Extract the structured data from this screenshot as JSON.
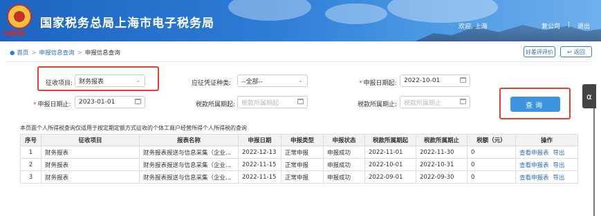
{
  "header": {
    "logo_text": "中國稅務",
    "title": "国家税务总局上海市电子税务局",
    "welcome": "欢迎, 上海",
    "company": "复公司",
    "separator": "|",
    "logout": "退出"
  },
  "breadcrumb": {
    "home": "首页",
    "sep1": ">",
    "level1": "申报信息查询",
    "sep2": ">",
    "current": "申报信息查询"
  },
  "actions": {
    "rating": "好差评评价",
    "back": "返回"
  },
  "form": {
    "collect_item_label": "征收项目:",
    "collect_item_value": "财务报表",
    "voucher_type_label": "应征凭证种类:",
    "voucher_type_value": "--全部--",
    "declare_start_label": "申报日期起:",
    "declare_start_value": "2022-10-01",
    "declare_end_label": "申报日期止:",
    "declare_end_value": "2023-01-01",
    "tax_period_start_label": "税款所属期起:",
    "tax_period_start_placeholder": "税款所属期起",
    "tax_period_end_label": "税款所属期止:",
    "tax_period_end_placeholder": "税款所属期止",
    "query_button": "查询"
  },
  "note": "本页面个人所得税查询仅适用于按定期定额方式征收的个体工商户经营所得个人所得税的查询",
  "table": {
    "headers": [
      "序号",
      "征收项目",
      "报表名称",
      "申报日期",
      "申报类型",
      "申报状态",
      "税款所属期起",
      "税款所属期止",
      "税额（元）",
      "操作"
    ],
    "rows": [
      {
        "no": "1",
        "item": "财务报表",
        "report": "财务报表报送与信息采集（企业...",
        "date": "2022-12-13",
        "type": "正常申报",
        "status": "申报成功",
        "start": "2022-11-01",
        "end": "2022-11-30",
        "amount": "0",
        "view": "查看申报表",
        "export": "导出"
      },
      {
        "no": "2",
        "item": "财务报表",
        "report": "财务报表报送与信息采集（企业...",
        "date": "2022-11-15",
        "type": "正常申报",
        "status": "申报成功",
        "start": "2022-10-01",
        "end": "2022-10-31",
        "amount": "0",
        "view": "查看申报表",
        "export": "导出"
      },
      {
        "no": "3",
        "item": "财务报表",
        "report": "财务报表报送与信息采集（企业...",
        "date": "2022-11-15",
        "type": "正常申报",
        "status": "申报成功",
        "start": "2022-09-01",
        "end": "2022-09-30",
        "amount": "0",
        "view": "查看申报表",
        "export": "导出"
      }
    ]
  },
  "icons": [
    "location-pin-icon",
    "back-arrow-icon",
    "chevron-down-icon",
    "calendar-icon",
    "headset-icon"
  ],
  "colors": {
    "header_blue": "#2d7cd6",
    "highlight_red": "#e8402b",
    "query_button": "#3f94e0",
    "link_blue": "#2d6cc0"
  }
}
